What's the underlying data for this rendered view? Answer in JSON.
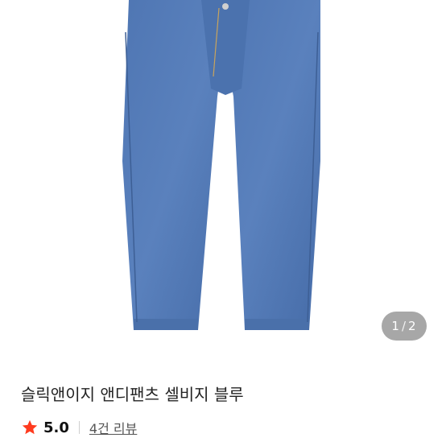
{
  "product": {
    "title": "슬릭앤이지 앤디팬츠 셀비지 블루",
    "image_alt": "jeans-photo",
    "image_index": "1",
    "image_separator": "/",
    "image_total": "2"
  },
  "rating": {
    "score": "5.0",
    "review_link": "4건 리뷰",
    "star_color": "#ff3b1f"
  }
}
